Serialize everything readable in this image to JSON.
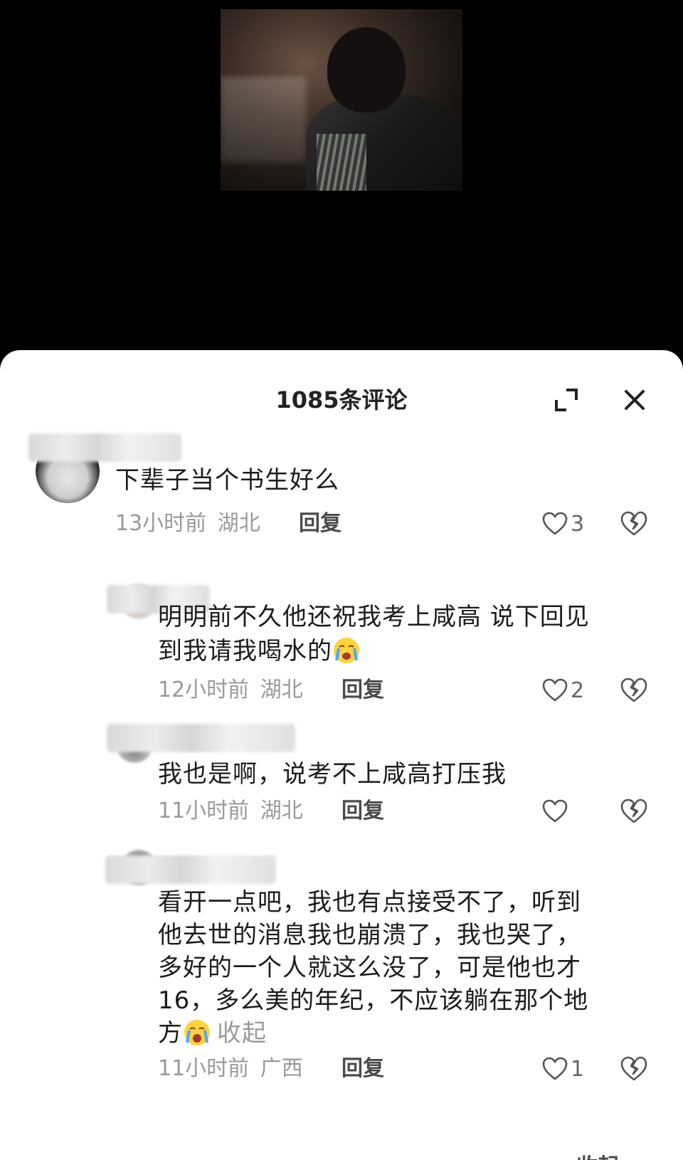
{
  "header": {
    "title": "1085条评论"
  },
  "comments": [
    {
      "text": "下辈子当个书生好么",
      "time": "13小时前",
      "location": "湖北",
      "reply_label": "回复",
      "likes": "3"
    },
    {
      "text_line1": "明明前不久他还祝我考上咸高 说下回见",
      "text_line2": "到我请我喝水的",
      "time": "12小时前",
      "location": "湖北",
      "reply_label": "回复",
      "likes": "2"
    },
    {
      "text": "我也是啊，说考不上咸高打压我",
      "time": "11小时前",
      "location": "湖北",
      "reply_label": "回复",
      "likes": ""
    },
    {
      "lines": [
        "看开一点吧，我也有点接受不了，听到",
        "他去世的消息我也崩溃了，我也哭了，",
        "多好的一个人就这么没了，可是他也才",
        "16，多么美的年纪，不应该躺在那个地",
        "方"
      ],
      "collapse_label": "收起",
      "time": "11小时前",
      "location": "广西",
      "reply_label": "回复",
      "likes": "1"
    }
  ],
  "footer": {
    "collapse_label": "收起"
  },
  "icons": {
    "expand": "expand-icon",
    "close": "close-icon",
    "like": "heart-icon",
    "dislike": "broken-heart-icon",
    "emoji_cry": "crying-emoji-icon"
  },
  "colors": {
    "sheet_bg": "#ffffff",
    "meta_text": "#9a9a9a",
    "page_bg": "#000000"
  }
}
